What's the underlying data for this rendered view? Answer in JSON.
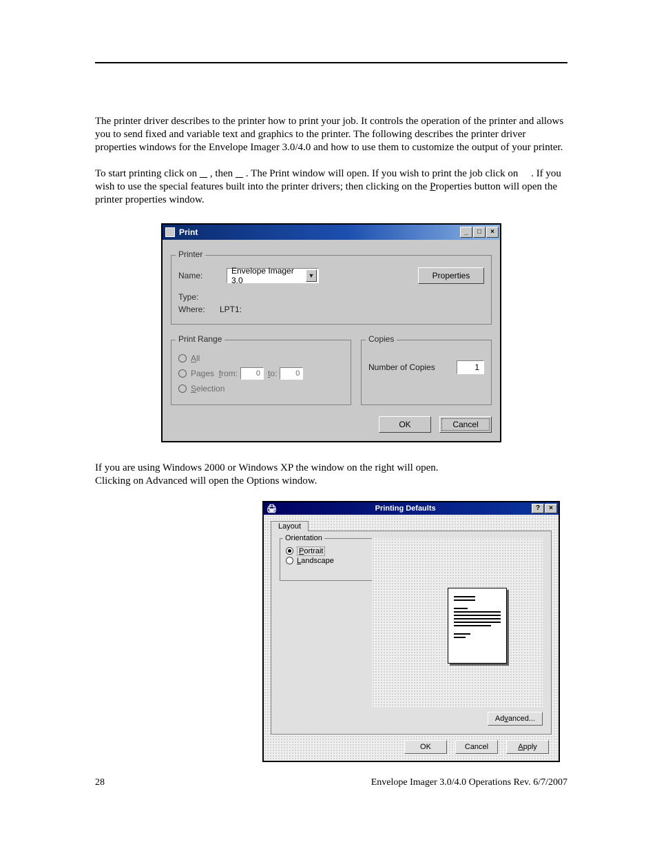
{
  "body": {
    "para1": "The printer driver describes to the printer how to print your job.  It controls the operation of the printer and allows you to send fixed and variable text and graphics to the printer.  The following describes the printer driver properties windows for the Envelope Imager 3.0/4.0 and how to use them to customize the output of your printer.",
    "para2_a": "To start printing click on ",
    "para2_b": " , then ",
    "para2_c": " .  The Print window will open.  If you wish to print the job click on ",
    "para2_d": " .  If you wish to use the special features built into the printer drivers; then clicking on the ",
    "para2_e": "roperties button will open the printer properties window.",
    "para2_P": "P",
    "para3": "If you are using Windows 2000 or Windows XP  the window on the right will open.",
    "para4": "Clicking on Advanced will open the Options window."
  },
  "print_dialog": {
    "title": "Print",
    "printer_group": "Printer",
    "name_label": "Name:",
    "name_value": "Envelope Imager 3.0",
    "properties_btn": "Properties",
    "type_label": "Type:",
    "where_label": "Where:",
    "where_value": "LPT1:",
    "range_group": "Print Range",
    "range_all": "All",
    "range_pages": "Pages",
    "range_from": "from:",
    "range_from_val": "0",
    "range_to": "to:",
    "range_to_val": "0",
    "range_selection": "Selection",
    "copies_group": "Copies",
    "copies_label": "Number of Copies",
    "copies_value": "1",
    "ok": "OK",
    "cancel": "Cancel"
  },
  "defaults_dialog": {
    "title": "Printing Defaults",
    "tab_layout": "Layout",
    "orient_group": "Orientation",
    "portrait": "ortrait",
    "portrait_u": "P",
    "landscape": "andscape",
    "landscape_u": "L",
    "advanced": "Advanced...",
    "advanced_u": "v",
    "ok": "OK",
    "cancel": "Cancel",
    "apply": "Apply",
    "apply_u": "A"
  },
  "footer": {
    "page": "28",
    "right": "Envelope Imager 3.0/4.0 Operations Rev. 6/7/2007"
  }
}
